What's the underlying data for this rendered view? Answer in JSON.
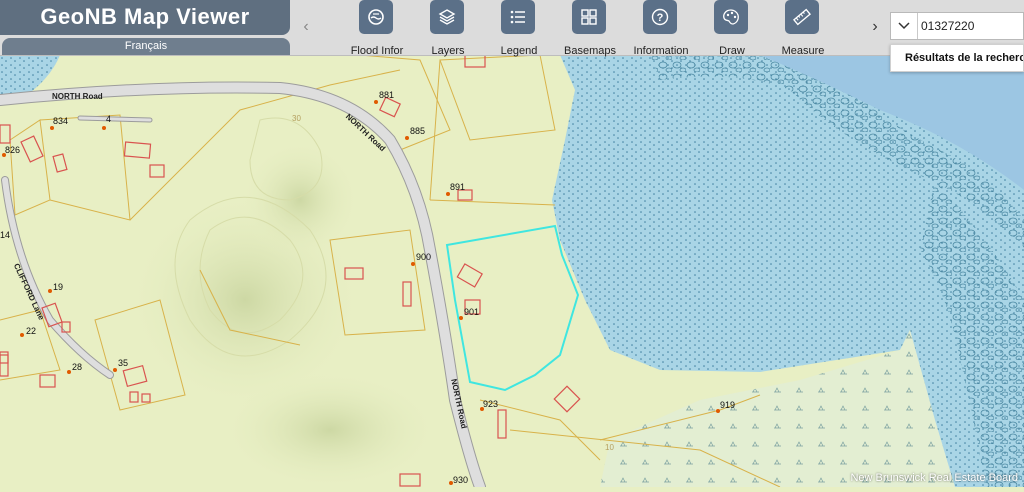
{
  "app": {
    "title": "GeoNB Map Viewer",
    "language_button": "Français"
  },
  "toolbar": {
    "prev_arrow": "‹",
    "next_arrow": "›",
    "tools": [
      {
        "label": "Flood Infor",
        "icon": "flood-icon"
      },
      {
        "label": "Layers",
        "icon": "layers-icon"
      },
      {
        "label": "Legend",
        "icon": "legend-icon"
      },
      {
        "label": "Basemaps",
        "icon": "basemaps-icon"
      },
      {
        "label": "Information",
        "icon": "information-icon"
      },
      {
        "label": "Draw",
        "icon": "draw-icon"
      },
      {
        "label": "Measure",
        "icon": "measure-icon"
      }
    ]
  },
  "search": {
    "value": "01327220",
    "results_label": "Résultats de la recherch"
  },
  "map": {
    "roads": {
      "north_road_a": "NORTH Road",
      "north_road_b": "NORTH Road",
      "north_road_c": "NORTH Road",
      "clifford_lane": "CLIFFORD Lane"
    },
    "parcel_numbers": {
      "p881": "881",
      "p834": "834",
      "p4": "4",
      "p885": "885",
      "p826": "826",
      "p891": "891",
      "p14": "14",
      "p900": "900",
      "p19": "19",
      "p901": "901",
      "p22": "22",
      "p35": "35",
      "p28": "28",
      "p923": "923",
      "p919": "919",
      "p930": "930"
    },
    "contour_labels": {
      "c30": "30",
      "c10": "10"
    },
    "attribution": "New Brunswick Real Estate Board"
  },
  "colors": {
    "land": "#e8efc4",
    "water": "#a9d5e6",
    "parcel_lines": "#d8b24a",
    "buildings": "#d9534f",
    "selected_parcel": "#3fe6e0",
    "toolbar_button": "#5b7088",
    "brand_bg": "#5f6f80"
  }
}
